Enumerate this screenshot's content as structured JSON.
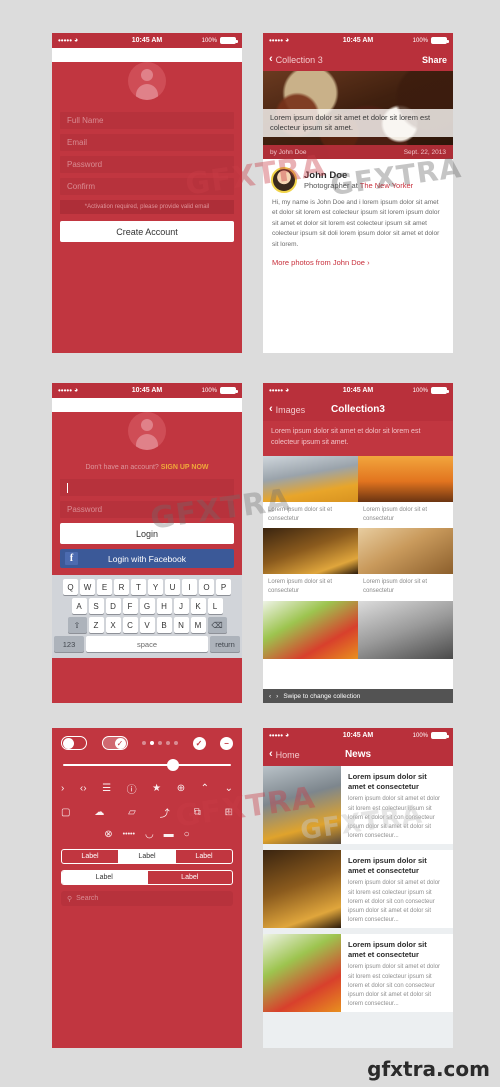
{
  "watermark": "gfxtra.com",
  "stamp_text": "GFXTRA",
  "colors": {
    "brand_red": "#c13640",
    "nav_red": "#b9303b",
    "facebook_blue": "#3b5998",
    "accent_orange": "#f0a93a",
    "link_red": "#c8303c"
  },
  "status_bar": {
    "signal": "•••••",
    "wifi": "wifi-icon",
    "time": "10:45 AM",
    "battery_label": "100%"
  },
  "screens": {
    "signup": {
      "name": "Create Account",
      "avatar": "avatar-placeholder-icon",
      "fields": [
        {
          "name": "full-name",
          "placeholder": "Full Name"
        },
        {
          "name": "email",
          "placeholder": "Email"
        },
        {
          "name": "password",
          "placeholder": "Password"
        },
        {
          "name": "confirm",
          "placeholder": "Confirm"
        }
      ],
      "note": "*Activation required, please provide valid email",
      "submit_label": "Create Account"
    },
    "article": {
      "back_label": "Collection 3",
      "action_label": "Share",
      "hero_image": "coffee-beans-and-cup-photo",
      "hero_overlay": "Lorem ipsum dolor sit amet et dolor sit lorem est colecteur ipsum sit amet.",
      "credit_by": "by John Doe",
      "credit_date": "Sept. 22, 2013",
      "author_name": "John Doe",
      "author_role_prefix": "Photographer at ",
      "author_company": "The New Yorker",
      "body": "Hi, my name is John Doe and i lorem ipsum dolor sit amet et dolor sit lorem est colecteur ipsum sit lorem ipsum dolor sit amet et dolor sit lorem est colecteur ipsum sit amet colecteur ipsum sit doli lorem ipsum dolor sit amet et dolor sit lorem.",
      "more_link": "More photos from John Doe"
    },
    "login": {
      "avatar": "avatar-placeholder-icon",
      "signup_prompt": "Don't have an account?",
      "signup_cta": "SIGN UP NOW",
      "username_value": "",
      "password_placeholder": "Password",
      "login_label": "Login",
      "facebook_label": "Login with Facebook",
      "facebook_icon": "f",
      "keyboard": {
        "row1": [
          "Q",
          "W",
          "E",
          "R",
          "T",
          "Y",
          "U",
          "I",
          "O",
          "P"
        ],
        "row2": [
          "A",
          "S",
          "D",
          "F",
          "G",
          "H",
          "J",
          "K",
          "L"
        ],
        "row3": [
          "Z",
          "X",
          "C",
          "V",
          "B",
          "N",
          "M"
        ],
        "shift": "⇧",
        "backspace": "⌫",
        "numbers": "123",
        "space": "space",
        "return": "return"
      }
    },
    "collection": {
      "back_label": "Images",
      "title": "Collection3",
      "description": "Lorem ipsum dolor sit amet et dolor sit lorem est colecteur ipsum sit amet.",
      "caption": "Lorem ipsum dolor sit et consectetur",
      "tiles": [
        {
          "image": "taxi-street-photo",
          "caption": "Lorem ipsum dolor sit et consectetur"
        },
        {
          "image": "big-ben-sunset-photo",
          "caption": "Lorem ipsum dolor sit et consectetur"
        },
        {
          "image": "hotel-sign-photo",
          "caption": "Lorem ipsum dolor sit et consectetur"
        },
        {
          "image": "bread-loaves-photo",
          "caption": "Lorem ipsum dolor sit et consectetur"
        }
      ],
      "wide_tiles": [
        {
          "image": "vegetables-photo"
        },
        {
          "image": "man-with-lens-photo"
        }
      ],
      "swipe_hint": "Swipe to change collection",
      "chev_left": "‹",
      "chev_right": "›"
    },
    "uikit": {
      "toggle_off": "toggle-off",
      "toggle_on": "toggle-on",
      "check_circle": "✓",
      "minus_circle": "−",
      "page_dots": 5,
      "page_dot_active_index": 1,
      "slider_percent": 62,
      "icons_row1": [
        "chevron-right-icon",
        "code-brackets-icon",
        "list-lines-icon",
        "info-circle-icon",
        "star-icon",
        "plus-circle-icon",
        "chevron-up-icon",
        "chevron-down-icon"
      ],
      "icons_row1_glyphs": [
        "›",
        "‹›",
        "☰",
        "ⓘ",
        "★",
        "⊕",
        "⌃",
        "⌄"
      ],
      "icons_row2": [
        "window-icon",
        "cloud-icon",
        "folder-icon",
        "share-icon",
        "copy-icon",
        "grid-icon"
      ],
      "icons_row2_glyphs": [
        "▢",
        "☁",
        "▱",
        "⤴",
        "⧉",
        "⊞"
      ],
      "icons_row3": [
        "close-circle-icon",
        "signal-dots-icon",
        "wifi-icon",
        "battery-icon",
        "refresh-icon"
      ],
      "icons_row3_glyphs": [
        "⊗",
        "•••••",
        "◡",
        "▬",
        "○"
      ],
      "segmented_three": [
        "Label",
        "Label",
        "Label"
      ],
      "segmented_three_selected": 1,
      "segmented_two": [
        "Label",
        "Label"
      ],
      "segmented_two_selected": 0,
      "search_placeholder": "Search",
      "search_icon": "search-icon"
    },
    "news": {
      "back_label": "Home",
      "title": "News",
      "items": [
        {
          "image": "street-scene-photo",
          "headline": "Lorem ipsum dolor sit amet et consectetur",
          "body": "lorem ipsum dolor sit amet et dolor sit lorem est colecteur ipsum sit lorem et dolor sit con consecteur ipsum dolor sit amet et dolor sit lorem consecteur..."
        },
        {
          "image": "hotel-sign-photo",
          "headline": "Lorem ipsum dolor sit amet et consectetur",
          "body": "lorem ipsum dolor sit amet et dolor sit lorem est colecteur ipsum sit lorem et dolor sit con consecteur ipsum dolor sit amet et dolor sit lorem consecteur..."
        },
        {
          "image": "vegetables-photo",
          "headline": "Lorem ipsum dolor sit amet et consectetur",
          "body": "lorem ipsum dolor sit amet et dolor sit lorem est colecteur ipsum sit lorem et dolor sit con consecteur ipsum dolor sit amet et dolor sit lorem consecteur..."
        }
      ]
    }
  }
}
